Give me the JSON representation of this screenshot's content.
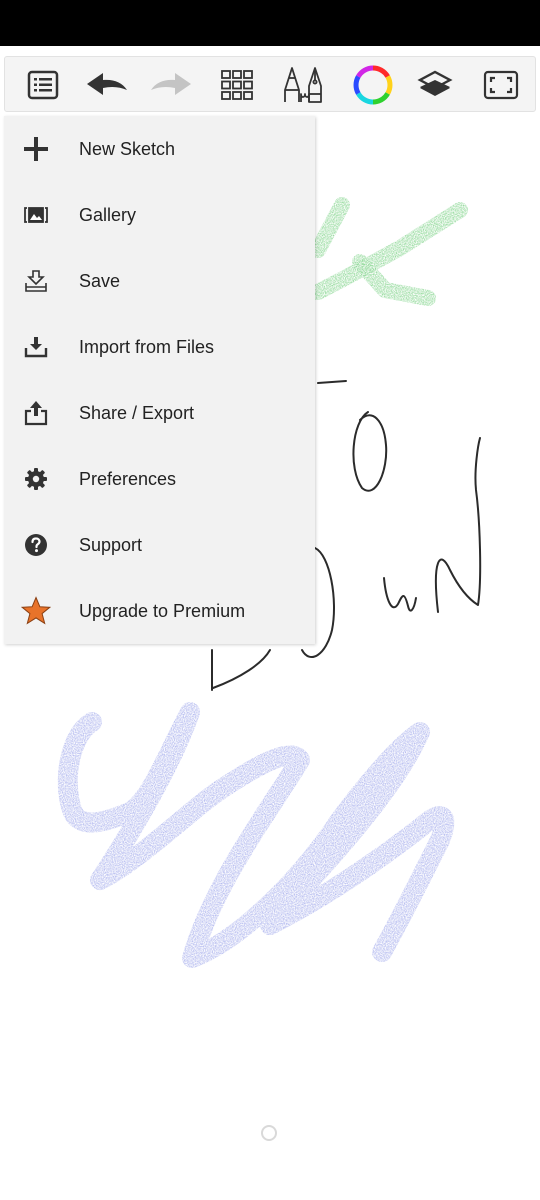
{
  "app": {
    "toolbar": {
      "buttons": [
        {
          "icon": "menu-list-icon",
          "state": "active"
        },
        {
          "icon": "undo-icon",
          "state": "enabled"
        },
        {
          "icon": "redo-icon",
          "state": "disabled"
        },
        {
          "icon": "brush-library-grid-icon",
          "state": "enabled"
        },
        {
          "icon": "brush-tools-icon",
          "state": "enabled"
        },
        {
          "icon": "color-wheel-icon",
          "state": "enabled"
        },
        {
          "icon": "layers-icon",
          "state": "enabled"
        },
        {
          "icon": "fullscreen-icon",
          "state": "enabled"
        }
      ]
    },
    "menu": {
      "items": [
        {
          "label": "New Sketch",
          "icon": "plus-icon"
        },
        {
          "label": "Gallery",
          "icon": "gallery-icon"
        },
        {
          "label": "Save",
          "icon": "save-icon"
        },
        {
          "label": "Import from Files",
          "icon": "import-icon"
        },
        {
          "label": "Share / Export",
          "icon": "share-icon"
        },
        {
          "label": "Preferences",
          "icon": "gear-icon"
        },
        {
          "label": "Support",
          "icon": "help-icon"
        },
        {
          "label": "Upgrade to Premium",
          "icon": "star-icon"
        }
      ]
    },
    "colors": {
      "toolbar_bg": "#f4f4f4",
      "menu_bg": "#f2f2f2",
      "icon": "#333333",
      "icon_disabled": "#c4c4c4",
      "premium_star": "#e8732a",
      "stroke_green": "#4cc25a",
      "stroke_blue": "#6f7be0",
      "stroke_pencil": "#2b2b2b"
    }
  }
}
